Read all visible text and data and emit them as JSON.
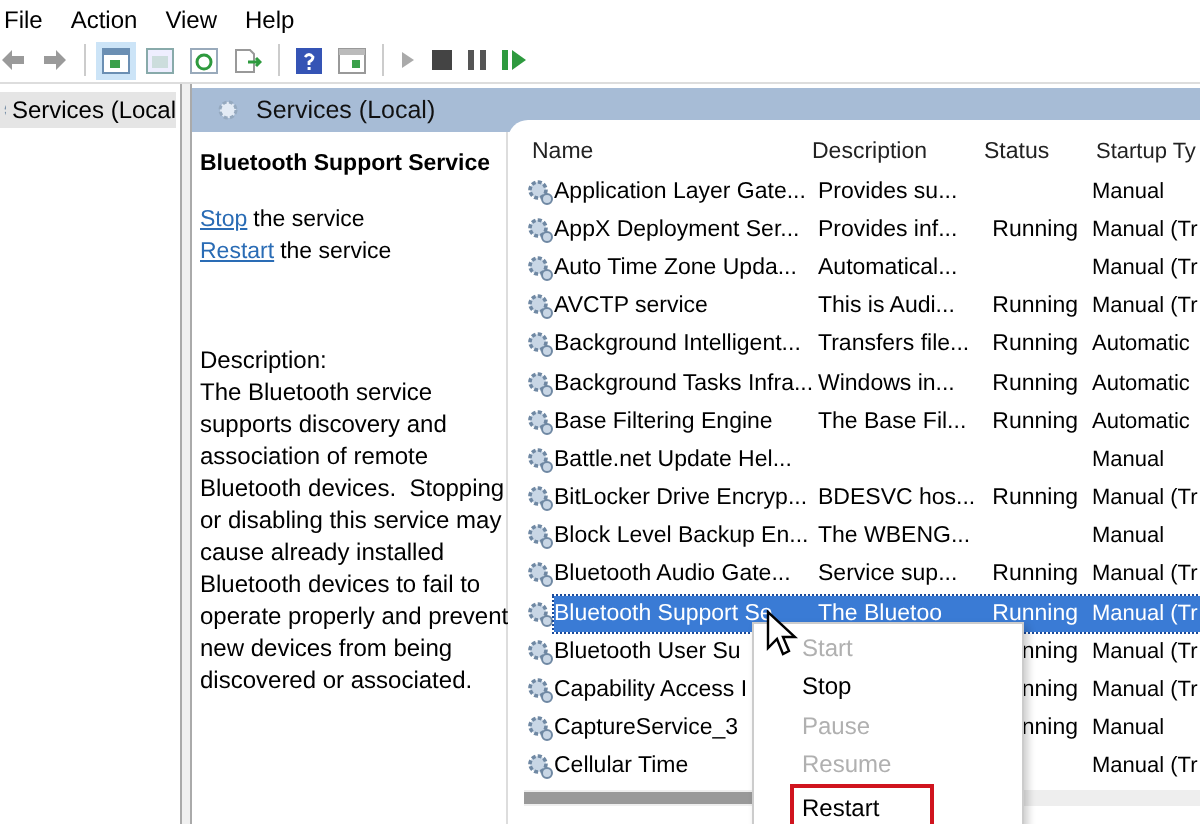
{
  "menu_bar": [
    "File",
    "Action",
    "View",
    "Help"
  ],
  "tree": {
    "label": "Services (Local",
    "selected": true
  },
  "header": {
    "title": "Services (Local)"
  },
  "detail": {
    "title": "Bluetooth Support Service",
    "actions": [
      {
        "link": "Stop",
        "text": "the service"
      },
      {
        "link": "Restart",
        "text": "the service"
      }
    ],
    "description_label": "Description:",
    "description": "The Bluetooth service supports discovery and association of remote Bluetooth devices.  Stopping or disabling this service may cause already installed Bluetooth devices to fail to operate properly and prevent new devices from being discovered or associated."
  },
  "table": {
    "columns": [
      "Name",
      "Description",
      "Status",
      "Startup Ty"
    ],
    "rows": [
      {
        "name": "Application Layer Gate...",
        "description": "Provides su...",
        "status": "",
        "startup": "Manual",
        "selected": false
      },
      {
        "name": "AppX Deployment Ser...",
        "description": "Provides inf...",
        "status": "Running",
        "startup": "Manual (Tr",
        "selected": false
      },
      {
        "name": "Auto Time Zone Upda...",
        "description": "Automatical...",
        "status": "",
        "startup": "Manual (Tr",
        "selected": false
      },
      {
        "name": "AVCTP service",
        "description": "This is Audi...",
        "status": "Running",
        "startup": "Manual (Tr",
        "selected": false
      },
      {
        "name": "Background Intelligent...",
        "description": "Transfers file...",
        "status": "Running",
        "startup": "Automatic",
        "selected": false
      },
      {
        "name": "Background Tasks Infra...",
        "description": "Windows in...",
        "status": "Running",
        "startup": "Automatic",
        "selected": false
      },
      {
        "name": "Base Filtering Engine",
        "description": "The Base Fil...",
        "status": "Running",
        "startup": "Automatic",
        "selected": false
      },
      {
        "name": "Battle.net Update Hel...",
        "description": "",
        "status": "",
        "startup": "Manual",
        "selected": false
      },
      {
        "name": "BitLocker Drive Encryp...",
        "description": "BDESVC hos...",
        "status": "Running",
        "startup": "Manual (Tr",
        "selected": false
      },
      {
        "name": "Block Level Backup En...",
        "description": "The WBENG...",
        "status": "",
        "startup": "Manual",
        "selected": false
      },
      {
        "name": "Bluetooth Audio Gate...",
        "description": "Service sup...",
        "status": "Running",
        "startup": "Manual (Tr",
        "selected": false
      },
      {
        "name": "Bluetooth Support Se",
        "description": "The Bluetoo",
        "status": "Running",
        "startup": "Manual (Tr",
        "selected": true
      },
      {
        "name": "Bluetooth User Su",
        "description": "",
        "status": "nning",
        "startup": "Manual (Tr",
        "selected": false
      },
      {
        "name": "Capability Access I",
        "description": "",
        "status": "nning",
        "startup": "Manual (Tr",
        "selected": false
      },
      {
        "name": "CaptureService_3",
        "description": "",
        "status": "nning",
        "startup": "Manual",
        "selected": false
      },
      {
        "name": "Cellular Time",
        "description": "",
        "status": "",
        "startup": "Manual (Tr",
        "selected": false
      }
    ]
  },
  "context_menu": [
    {
      "label": "Start",
      "disabled": true,
      "highlighted": false
    },
    {
      "label": "Stop",
      "disabled": false,
      "highlighted": false
    },
    {
      "label": "Pause",
      "disabled": true,
      "highlighted": false
    },
    {
      "label": "Resume",
      "disabled": true,
      "highlighted": false
    },
    {
      "label": "Restart",
      "disabled": false,
      "highlighted": true
    }
  ]
}
